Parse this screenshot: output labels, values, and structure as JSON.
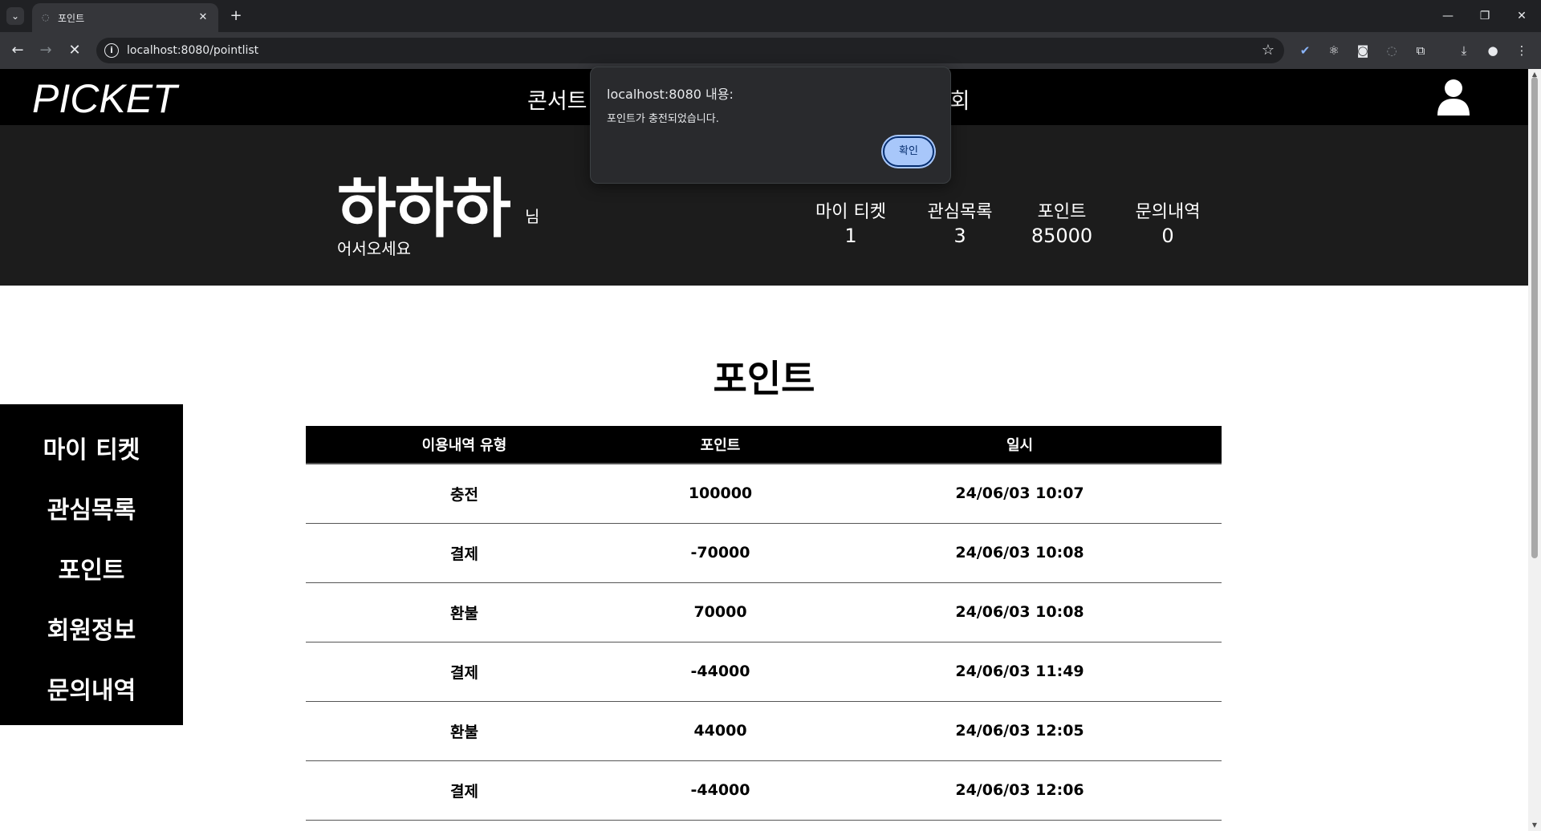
{
  "browser": {
    "tab_title": "포인트",
    "url": "localhost:8080/pointlist",
    "new_tab_symbol": "+",
    "tab_close_symbol": "✕",
    "window_minimize": "—",
    "window_restore": "❐",
    "window_close": "✕"
  },
  "site": {
    "logo": "PICKET",
    "nav": [
      "콘서트",
      "전시회"
    ]
  },
  "profile": {
    "nickname": "하하하",
    "honorific": "님",
    "welcome": "어서오세요",
    "stats": [
      {
        "label": "마이 티켓",
        "value": "1"
      },
      {
        "label": "관심목록",
        "value": "3"
      },
      {
        "label": "포인트",
        "value": "85000"
      },
      {
        "label": "문의내역",
        "value": "0"
      }
    ]
  },
  "sidebar": {
    "items": [
      "마이 티켓",
      "관심목록",
      "포인트",
      "회원정보",
      "문의내역"
    ]
  },
  "main": {
    "title": "포인트",
    "columns": [
      "이용내역 유형",
      "포인트",
      "일시"
    ],
    "rows": [
      {
        "type": "충전",
        "points": "100000",
        "date": "24/06/03 10:07"
      },
      {
        "type": "결제",
        "points": "-70000",
        "date": "24/06/03 10:08"
      },
      {
        "type": "환불",
        "points": "70000",
        "date": "24/06/03 10:08"
      },
      {
        "type": "결제",
        "points": "-44000",
        "date": "24/06/03 11:49"
      },
      {
        "type": "환불",
        "points": "44000",
        "date": "24/06/03 12:05"
      },
      {
        "type": "결제",
        "points": "-44000",
        "date": "24/06/03 12:06"
      }
    ]
  },
  "alert": {
    "title": "localhost:8080 내용:",
    "message": "포인트가 충전되었습니다.",
    "ok_label": "확인"
  }
}
